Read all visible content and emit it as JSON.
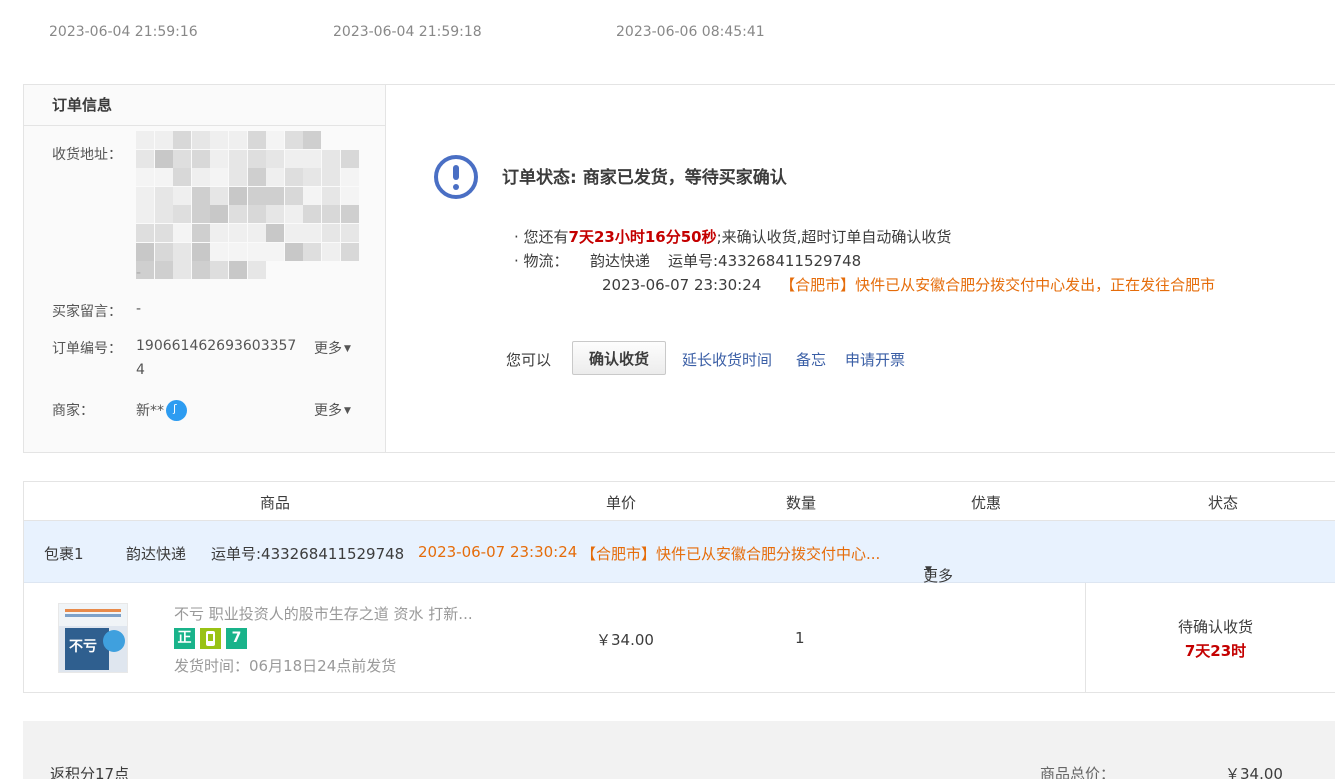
{
  "timeline": {
    "times": [
      "2023-06-04 21:59:16",
      "2023-06-04 21:59:18",
      "2023-06-06 08:45:41"
    ]
  },
  "order_info": {
    "title": "订单信息",
    "address_label": "收货地址：",
    "address_dash": "-",
    "message_label": "买家留言：",
    "message_value": "-",
    "order_no_label": "订单编号：",
    "order_no_line1": "190661462693603357",
    "order_no_line2": "4",
    "more": "更多",
    "seller_label": "商家：",
    "seller_value": "新**"
  },
  "status": {
    "title": "订单状态: 商家已发货，等待买家确认",
    "remaining_prefix": "· 您还有",
    "countdown": "7天23小时16分50秒",
    "remaining_suffix": ";来确认收货,超时订单自动确认收货",
    "logistics_label": "· 物流：",
    "carrier": "韵达快递",
    "waybill": "运单号:433268411529748",
    "track_time": "2023-06-07 23:30:24",
    "track_text": "【合肥市】快件已从安徽合肥分拨交付中心发出，正在发往合肥市"
  },
  "actions": {
    "lead": "您可以",
    "confirm": "确认收货",
    "extend": "延长收货时间",
    "memo": "备忘",
    "invoice": "申请开票"
  },
  "goods_table": {
    "headers": [
      "商品",
      "单价",
      "数量",
      "优惠",
      "状态"
    ],
    "package": {
      "label": "包裹1",
      "carrier": "韵达快递",
      "waybill": "运单号:433268411529748",
      "time": "2023-06-07 23:30:24",
      "text": "【合肥市】快件已从安徽合肥分拨交付中心...",
      "more": "更多"
    },
    "item": {
      "title": "不亏 职业投资人的股市生存之道 资水 打新...",
      "badges": [
        {
          "text": "正",
          "color": "#19b38a"
        },
        {
          "text": "",
          "icon": "phone-icon",
          "color": "#99c215"
        },
        {
          "text": "7",
          "color": "#19b38a"
        }
      ],
      "ship_time": "发货时间：06月18日24点前发货",
      "price": "￥34.00",
      "quantity": "1",
      "state": "待确认收货",
      "state_time": "7天23时"
    }
  },
  "summary": {
    "points": "返积分17点",
    "total_label": "商品总价：",
    "total_value": "￥34.00"
  }
}
